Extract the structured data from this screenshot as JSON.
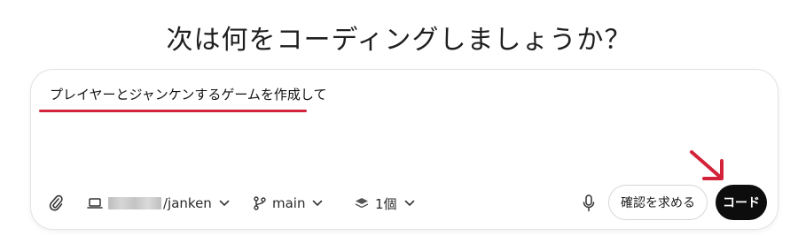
{
  "heading": "次は何をコーディングしましょうか？",
  "prompt_text": "プレイヤーとジャンケンするゲームを作成して",
  "toolbar": {
    "attach_icon": "paperclip-icon",
    "repo_icon": "laptop-icon",
    "repo_suffix": "/janken",
    "branch_icon": "git-branch-icon",
    "branch": "main",
    "env_icon": "layers-icon",
    "env_count": "1個",
    "mic_icon": "microphone-icon"
  },
  "buttons": {
    "confirm": "確認を求める",
    "code": "コード"
  },
  "annotation_colors": {
    "underline": "#d3233a",
    "arrow": "#d3233a"
  }
}
